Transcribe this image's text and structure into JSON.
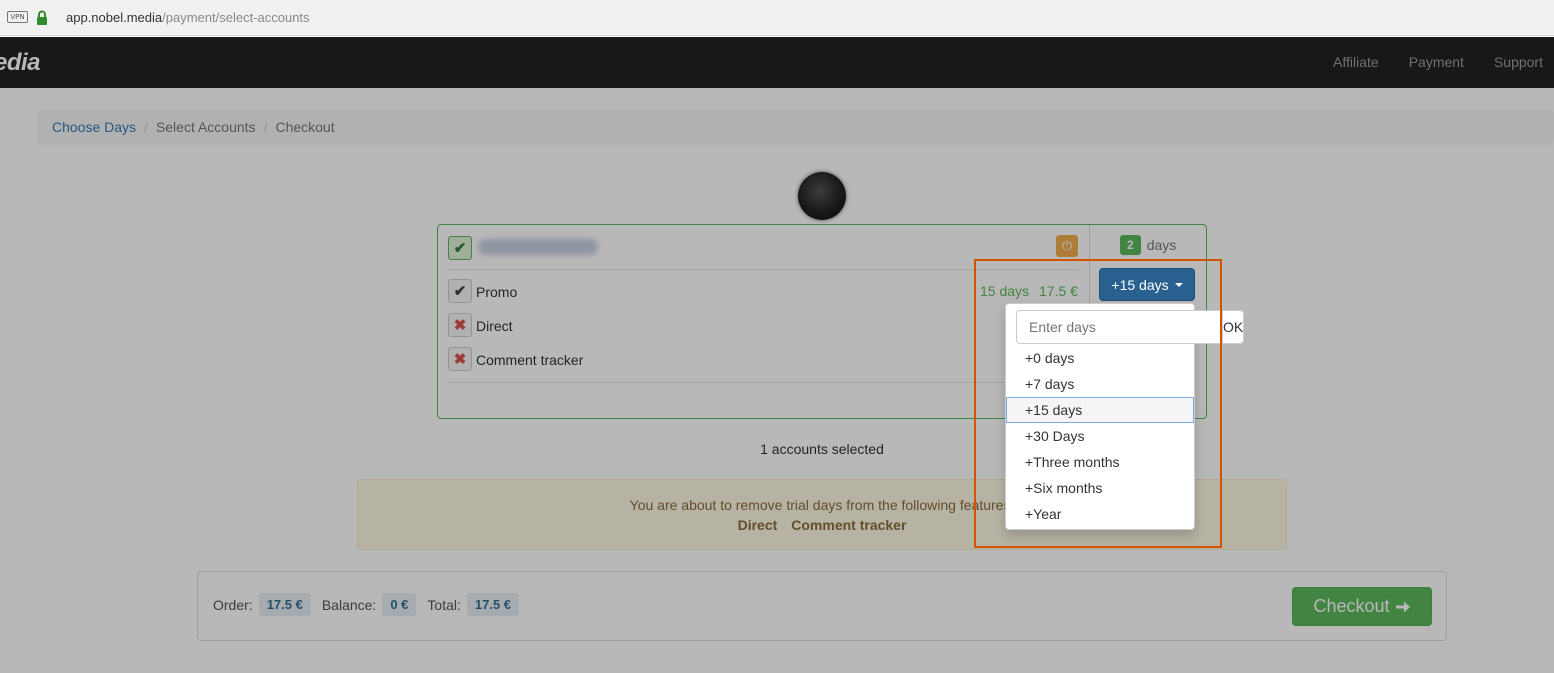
{
  "browser": {
    "vpn_label": "VPN",
    "url_host": "app.nobel.media",
    "url_path": "/payment/select-accounts"
  },
  "navbar": {
    "brand": "edia",
    "links": [
      "Affiliate",
      "Payment",
      "Support"
    ]
  },
  "breadcrumb": {
    "items": [
      "Choose Days",
      "Select Accounts",
      "Checkout"
    ],
    "separator": "/"
  },
  "account": {
    "days_count": "2",
    "days_label": "days",
    "features": [
      {
        "name": "Promo",
        "enabled": true
      },
      {
        "name": "Direct",
        "enabled": false
      },
      {
        "name": "Comment tracker",
        "enabled": false
      }
    ],
    "promo_days": "15 days",
    "promo_price": "17.5 €"
  },
  "selection": {
    "summary": "1 accounts selected"
  },
  "alert": {
    "message": "You are about to remove trial days from the following features:",
    "features": [
      "Direct",
      "Comment tracker"
    ]
  },
  "order": {
    "order_label": "Order:",
    "order_value": "17.5 €",
    "balance_label": "Balance:",
    "balance_value": "0 €",
    "total_label": "Total:",
    "total_value": "17.5 €",
    "checkout_label": "Checkout"
  },
  "days_dropdown": {
    "button_label": "+15 days",
    "input_placeholder": "Enter days",
    "ok_label": "OK",
    "options": [
      "+0 days",
      "+7 days",
      "+15 days",
      "+30 Days",
      "+Three months",
      "+Six months",
      "+Year"
    ],
    "selected": "+15 days"
  },
  "colors": {
    "success": "#5cb85c",
    "primary": "#286090",
    "warning_bg": "#fcf8e3",
    "highlight": "#d35400"
  }
}
